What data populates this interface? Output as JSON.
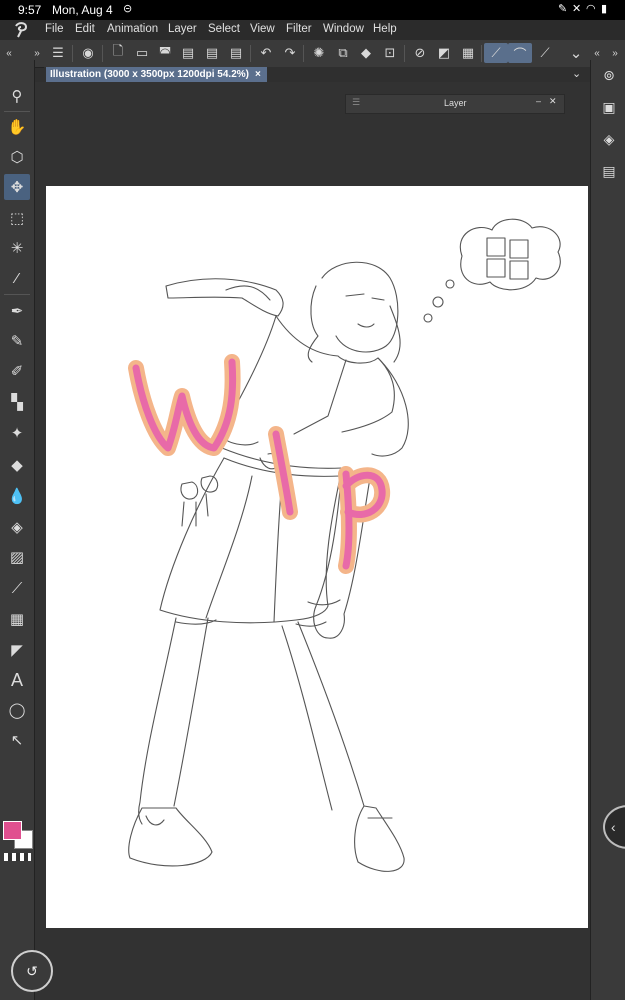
{
  "status_bar": {
    "time": "9:57",
    "date": "Mon, Aug 4",
    "icons": [
      "notification-icon",
      "pen-icon",
      "mute-icon",
      "wifi-icon",
      "battery-icon"
    ]
  },
  "menu": {
    "items": [
      "File",
      "Edit",
      "Animation",
      "Layer",
      "Select",
      "View",
      "Filter",
      "Window",
      "Help"
    ]
  },
  "document": {
    "tab_title": "Illustration (3000 x 3500px 1200dpi 54.2%)",
    "close_glyph": "×"
  },
  "layer_palette": {
    "title": "Layer"
  },
  "colors": {
    "main_color": "#e0508f",
    "sub_color": "#ffffff",
    "accent_selected": "#4a6280",
    "canvas_bg": "#323232",
    "wip_outer": "#f4b58a",
    "wip_inner": "#e86aa8"
  },
  "canvas": {
    "overlay_text": "Wip"
  }
}
